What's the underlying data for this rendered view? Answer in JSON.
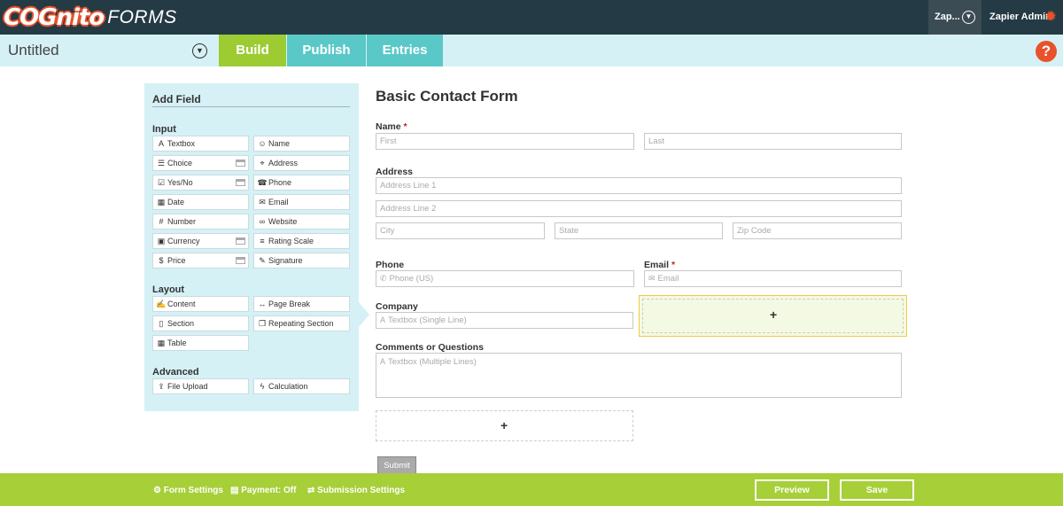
{
  "header": {
    "logo_main": "COGnito",
    "logo_suffix": "FORMS",
    "account_label": "Zap...",
    "user_label": "Zapier Admin"
  },
  "subheader": {
    "form_title": "Untitled",
    "tabs": [
      {
        "label": "Build",
        "active": true
      },
      {
        "label": "Publish"
      },
      {
        "label": "Entries"
      }
    ],
    "help_label": "?"
  },
  "add_field": {
    "title": "Add Field",
    "sections": [
      {
        "title": "Input",
        "fields": [
          {
            "label": "Textbox",
            "icon": "text-A-icon"
          },
          {
            "label": "Name",
            "icon": "smiley-icon"
          },
          {
            "label": "Choice",
            "icon": "list-icon",
            "payment": true
          },
          {
            "label": "Address",
            "icon": "map-pin-icon"
          },
          {
            "label": "Yes/No",
            "icon": "checkbox-icon",
            "payment": true
          },
          {
            "label": "Phone",
            "icon": "phone-icon"
          },
          {
            "label": "Date",
            "icon": "calendar-icon"
          },
          {
            "label": "Email",
            "icon": "envelope-icon"
          },
          {
            "label": "Number",
            "icon": "hash-icon"
          },
          {
            "label": "Website",
            "icon": "link-icon"
          },
          {
            "label": "Currency",
            "icon": "money-icon",
            "payment": true
          },
          {
            "label": "Rating Scale",
            "icon": "rating-icon"
          },
          {
            "label": "Price",
            "icon": "dollar-icon",
            "payment": true
          },
          {
            "label": "Signature",
            "icon": "pen-icon"
          }
        ]
      },
      {
        "title": "Layout",
        "fields": [
          {
            "label": "Content",
            "icon": "edit-icon"
          },
          {
            "label": "Page Break",
            "icon": "arrows-horizontal-icon"
          },
          {
            "label": "Section",
            "icon": "file-icon"
          },
          {
            "label": "Repeating Section",
            "icon": "copy-icon"
          },
          {
            "label": "Table",
            "icon": "table-icon"
          }
        ]
      },
      {
        "title": "Advanced",
        "fields": [
          {
            "label": "File Upload",
            "icon": "upload-icon"
          },
          {
            "label": "Calculation",
            "icon": "bolt-icon"
          }
        ]
      }
    ]
  },
  "form": {
    "title": "Basic Contact Form",
    "name": {
      "label": "Name",
      "required": "*",
      "first_placeholder": "First",
      "last_placeholder": "Last"
    },
    "address": {
      "label": "Address",
      "line1": "Address Line 1",
      "line2": "Address Line 2",
      "city": "City",
      "state": "State",
      "zip": "Zip Code"
    },
    "phone": {
      "label": "Phone",
      "placeholder": "Phone (US)"
    },
    "email": {
      "label": "Email",
      "required": "*",
      "placeholder": "Email"
    },
    "company": {
      "label": "Company",
      "placeholder": "Textbox (Single Line)"
    },
    "comments": {
      "label": "Comments or Questions",
      "placeholder": "Textbox (Multiple Lines)"
    },
    "add_placeholder_symbol": "+",
    "submit_label": "Submit"
  },
  "footer": {
    "form_settings": "Form Settings",
    "payment": "Payment: Off",
    "submission_settings": "Submission Settings",
    "preview_label": "Preview",
    "save_label": "Save"
  },
  "colors": {
    "header_bg": "#243a44",
    "accent_green": "#9ccb32",
    "accent_teal": "#5bc8c8",
    "panel_bg": "#d5f1f5",
    "brand_orange": "#e8522b",
    "footer_bg": "#a6cf38"
  }
}
